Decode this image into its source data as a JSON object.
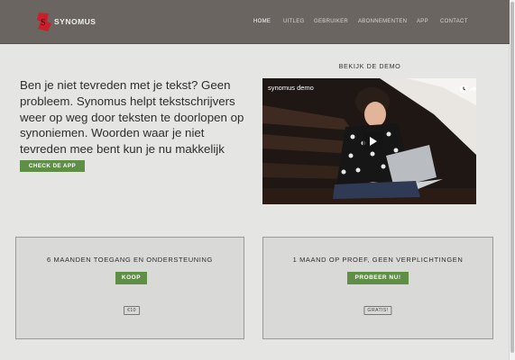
{
  "header": {
    "logo_text": "SYNOMUS",
    "nav": [
      "HOME",
      "UITLEG",
      "GEBRUIKER",
      "ABONNEMENTEN",
      "APP",
      "CONTACT"
    ],
    "active": "HOME"
  },
  "hero": {
    "text": "Ben je niet tevreden met je tekst? Geen probleem. Synomus helpt tekstschrijvers weer op weg door teksten te doorlopen op synoniemen. Woorden waar je niet tevreden mee bent kun je nu makkelijk veranderen.",
    "cta": "CHECK DE APP"
  },
  "demo": {
    "label": "BEKIJK DE DEMO",
    "video_title": "synomus demo"
  },
  "plans": [
    {
      "title": "6 MAANDEN TOEGANG EN ONDERSTEUNING",
      "button": "KOOP",
      "price": "€10"
    },
    {
      "title": "1 MAAND OP PROEF, GEEN VERPLICHTINGEN",
      "button": "PROBEER NU!",
      "price": "GRATIS!"
    }
  ],
  "colors": {
    "header_bg": "#6a6560",
    "accent_green": "#5f8e47",
    "logo_red": "#c8202a",
    "page_bg": "#e5e5e3"
  },
  "icons": [
    "logo-mark-icon",
    "clock-icon",
    "share-icon",
    "play-icon"
  ]
}
